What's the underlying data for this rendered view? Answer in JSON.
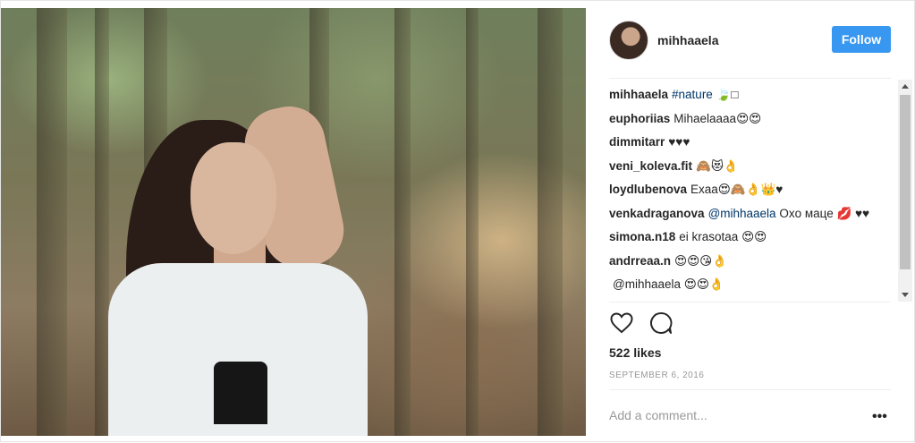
{
  "post": {
    "username": "mihhaaela",
    "follow_label": "Follow"
  },
  "comments": [
    {
      "user": "mihhaaela",
      "tag": "#nature",
      "text": "🍃□"
    },
    {
      "user": "euphoriias",
      "text": "Mihaelaaaa😍😍"
    },
    {
      "user": "dimmitarr",
      "text": "♥♥♥"
    },
    {
      "user": "veni_koleva.fit",
      "text": "🙈😻👌"
    },
    {
      "user": "loydlubenova",
      "text": "Exaa😍🙈👌👑♥"
    },
    {
      "user": "venkadraganova",
      "tag": "@mihhaaela",
      "text": "Oxo маце 💋 ♥♥"
    },
    {
      "user": "simona.n18",
      "text": "ei krasotaa 😍😍"
    },
    {
      "user": "andrreaa.n",
      "text": "😍😍😘👌"
    },
    {
      "user": "",
      "text": "@mihhaaela 😍😍👌"
    }
  ],
  "actions": {
    "like_icon": "heart-icon",
    "comment_icon": "comment-bubble-icon"
  },
  "stats": {
    "likes": "522 likes",
    "date": "SEPTEMBER 6, 2016"
  },
  "footer": {
    "add_comment_placeholder": "Add a comment...",
    "more_label": "•••"
  }
}
